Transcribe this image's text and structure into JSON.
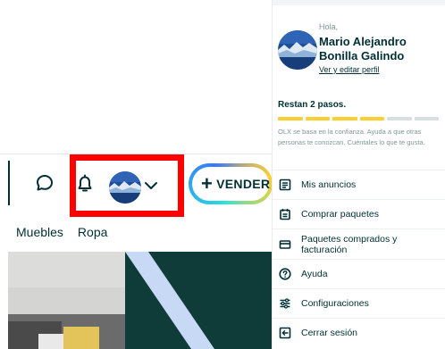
{
  "header": {
    "sell_label": "VENDER",
    "sell_plus": "+",
    "icons": [
      "chat-icon",
      "bell-icon",
      "chevron-down-icon"
    ]
  },
  "categories": [
    "Muebles",
    "Ropa"
  ],
  "dropdown": {
    "greeting": "Hola,",
    "user_name": "Mario Alejandro Bonilla Galindo",
    "profile_link": "Ver y editar perfil",
    "steps_title": "Restan 2 pasos.",
    "progress": {
      "completed": 4,
      "total": 6
    },
    "progress_note": "OLX se basa en la confianza. Ayuda a que otras personas te conozcan. Cuéntales lo que te gusta.",
    "menu": [
      {
        "label": "Mis anuncios",
        "icon": "listing-icon"
      },
      {
        "label": "Comprar paquetes",
        "icon": "package-icon"
      },
      {
        "label": "Paquetes comprados y facturación",
        "icon": "card-icon"
      },
      {
        "label": "Ayuda",
        "icon": "help-icon"
      },
      {
        "label": "Configuraciones",
        "icon": "settings-icon"
      },
      {
        "label": "Cerrar sesión",
        "icon": "logout-icon"
      }
    ]
  },
  "colors": {
    "text": "#002f34",
    "highlight_border": "#ff0000",
    "progress_done": "#ffce32",
    "progress_todo": "#d8dfe0",
    "banner_dark": "#0f3b39"
  }
}
